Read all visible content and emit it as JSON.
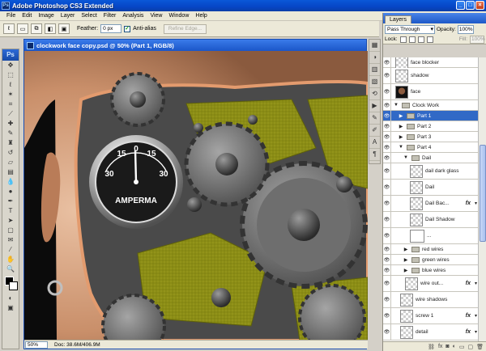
{
  "app": {
    "title": "Adobe Photoshop CS3 Extended",
    "logo": "Ps"
  },
  "menu": [
    "File",
    "Edit",
    "Image",
    "Layer",
    "Select",
    "Filter",
    "Analysis",
    "View",
    "Window",
    "Help"
  ],
  "options": {
    "feather_label": "Feather:",
    "feather_value": "0 px",
    "antialias_label": "Anti-alias",
    "antialias_checked": true,
    "refine_label": "Refine Edge..."
  },
  "document": {
    "title": "clockwork face copy.psd @ 50% (Part 1, RGB/8)",
    "zoom": "50%",
    "doc_info": "Doc: 38.6M/406.9M",
    "gauge": {
      "scale_labels": [
        "30",
        "15",
        "0",
        "15",
        "30"
      ],
      "brand": "AMPERMA"
    }
  },
  "layers_panel": {
    "tab_label": "Layers",
    "blend_mode": "Pass Through",
    "opacity_label": "Opacity:",
    "opacity_value": "100%",
    "lock_label": "Lock:",
    "fill_label": "Fill:",
    "fill_value": "100%",
    "layers": [
      {
        "name": "face blocker",
        "kind": "layer",
        "indent": 0,
        "visible": true,
        "size": "sm"
      },
      {
        "name": "shadow",
        "kind": "layer",
        "indent": 0,
        "visible": true,
        "size": "big"
      },
      {
        "name": "face",
        "kind": "layer",
        "indent": 0,
        "visible": true,
        "size": "big"
      },
      {
        "name": "Clock Work",
        "kind": "group",
        "indent": 0,
        "visible": true,
        "open": true,
        "size": "sm"
      },
      {
        "name": "Part 1",
        "kind": "group",
        "indent": 1,
        "visible": true,
        "open": false,
        "selected": true,
        "size": "sm"
      },
      {
        "name": "Part 2",
        "kind": "group",
        "indent": 1,
        "visible": true,
        "open": false,
        "size": "sm"
      },
      {
        "name": "Part 3",
        "kind": "group",
        "indent": 1,
        "visible": true,
        "open": false,
        "size": "sm"
      },
      {
        "name": "Part 4",
        "kind": "group",
        "indent": 1,
        "visible": true,
        "open": true,
        "size": "sm"
      },
      {
        "name": "Dail",
        "kind": "group",
        "indent": 2,
        "visible": true,
        "open": true,
        "size": "sm"
      },
      {
        "name": "dail dark glass",
        "kind": "layer",
        "indent": 3,
        "visible": true,
        "size": "big"
      },
      {
        "name": "Dail",
        "kind": "layer",
        "indent": 3,
        "visible": true,
        "size": "big"
      },
      {
        "name": "Dail Bac...",
        "kind": "layer",
        "indent": 3,
        "visible": true,
        "fx": true,
        "size": "big"
      },
      {
        "name": "Dail Shadow",
        "kind": "layer",
        "indent": 3,
        "visible": true,
        "size": "big"
      },
      {
        "name": "...",
        "kind": "mask",
        "indent": 3,
        "visible": true,
        "size": "big"
      },
      {
        "name": "red wires",
        "kind": "group",
        "indent": 2,
        "visible": true,
        "open": false,
        "size": "sm"
      },
      {
        "name": "green wires",
        "kind": "group",
        "indent": 2,
        "visible": true,
        "open": false,
        "size": "sm"
      },
      {
        "name": "blue wires",
        "kind": "group",
        "indent": 2,
        "visible": true,
        "open": false,
        "size": "sm"
      },
      {
        "name": "wire out...",
        "kind": "layer",
        "indent": 2,
        "visible": true,
        "fx": true,
        "size": "big"
      },
      {
        "name": "wire shadows",
        "kind": "layer",
        "indent": 1,
        "visible": true,
        "size": "big"
      },
      {
        "name": "screw 1",
        "kind": "layer",
        "indent": 1,
        "visible": true,
        "fx": true,
        "size": "big"
      },
      {
        "name": "detail",
        "kind": "layer",
        "indent": 1,
        "visible": true,
        "fx": true,
        "size": "big"
      }
    ]
  },
  "colors": {
    "accent": "#3169c6",
    "olive": "#8a8c12",
    "skin": "#d9a583"
  }
}
